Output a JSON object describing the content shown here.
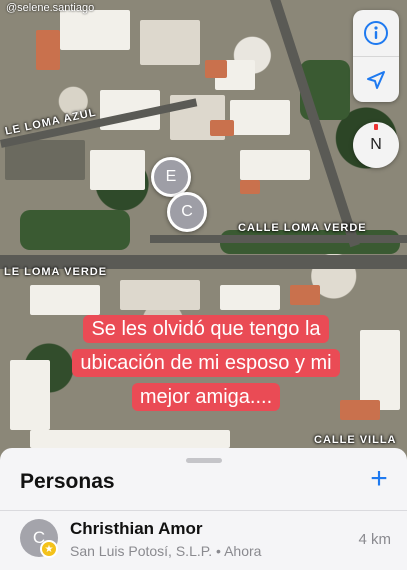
{
  "watermark": "@selene.santiago",
  "map": {
    "labels": {
      "loma_azul": "LE LOMA AZUL",
      "calle_loma_verde": "CALLE LOMA VERDE",
      "loma_verde_left": "LE LOMA VERDE",
      "calle_villa": "CALLE VILLA"
    },
    "pins": [
      {
        "initial": "E"
      },
      {
        "initial": "C"
      }
    ],
    "compass": "N",
    "info_icon": "info-icon",
    "location_icon": "location-arrow-icon"
  },
  "caption": "Se les olvidó que tengo la ubicación de mi esposo y mi mejor amiga....",
  "sheet": {
    "title": "Personas",
    "add_label": "+",
    "people": [
      {
        "initial": "C",
        "name": "Christhian Amor",
        "location": "San Luis Potosí, S.L.P. • Ahora",
        "distance": "4 km",
        "badge_icon": "star-icon"
      }
    ]
  },
  "colors": {
    "accent": "#1f7af0",
    "caption_bg": "#ea4b55",
    "pin": "#9e9ea6",
    "badge": "#f4c21b"
  }
}
